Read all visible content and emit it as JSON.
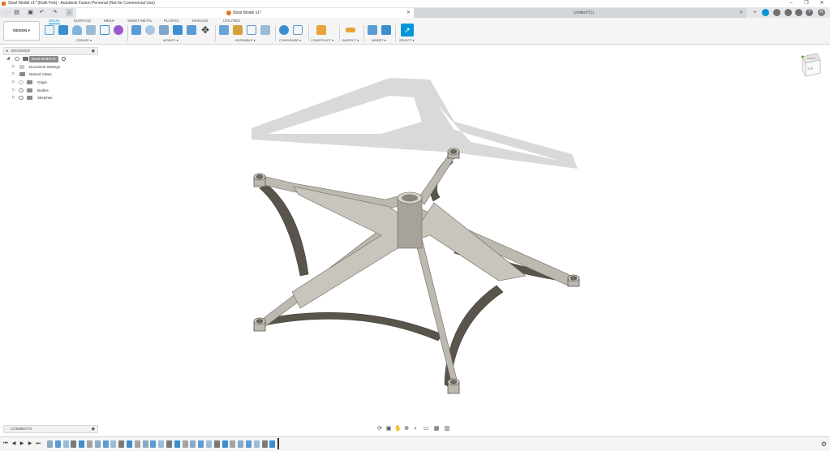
{
  "window": {
    "title": "Stool Model v1* (Kwik Feb) - Autodesk Fusion Personal (Not for Commercial Use)",
    "minimize": "–",
    "maximize": "❐",
    "close": "✕"
  },
  "tabs": {
    "grid_icon": "⋮⋮⋮",
    "file_icon": "▤",
    "save_icon": "▣",
    "undo_icon": "↶",
    "redo_icon": "↷",
    "home_icon": "⌂",
    "active": {
      "label": "Stool Model v1*",
      "close": "✕"
    },
    "inactive": {
      "label": "Untitled*(1)",
      "close": "✕"
    },
    "new_tab": "+",
    "right_icons": [
      "cloud-icon",
      "clock-icon",
      "notifications-icon",
      "help-icon",
      "avatar"
    ],
    "help_label": "?",
    "avatar_label": "A"
  },
  "ribbon": {
    "workspace": "DESIGN ▾",
    "tabs": [
      "SOLID",
      "SURFACE",
      "MESH",
      "SHEET METAL",
      "PLASTIC",
      "MANAGE",
      "UTILITIES"
    ],
    "active_tab": "SOLID",
    "groups": {
      "create": "CREATE ▾",
      "modify": "MODIFY ▾",
      "assemble": "ASSEMBLE ▾",
      "configure": "CONFIGURE ▾",
      "construct": "CONSTRUCT ▾",
      "inspect": "INSPECT ▾",
      "insert": "INSERT ▾",
      "select": "SELECT ▾"
    }
  },
  "browser": {
    "title": "BROWSER",
    "root": "Stool Model v1",
    "items": [
      "Document Settings",
      "Named Views",
      "Origin",
      "Bodies",
      "Sketches"
    ]
  },
  "viewcube": {
    "front": "FRONT",
    "top": "TOP"
  },
  "comments": {
    "title": "COMMENTS"
  },
  "colors": {
    "accent": "#0696d7",
    "model_face": "#bdb9b0",
    "model_shadow_side": "#5a554c",
    "shadow": "#d9d9d9"
  }
}
